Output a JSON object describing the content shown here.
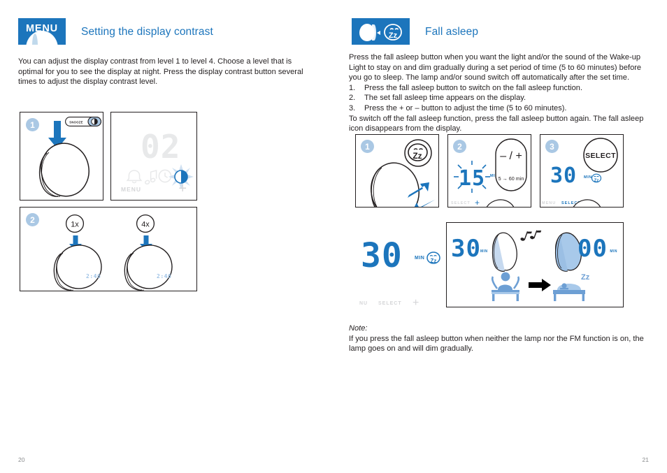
{
  "document": {
    "left_page_number": "20",
    "right_page_number": "21"
  },
  "colors": {
    "brand_blue": "#1c75bc",
    "step_badge": "#aac8e4",
    "text": "#231f20",
    "ghost_grey": "#e8e9ea"
  },
  "left": {
    "header": {
      "badge_label": "MENU",
      "badge_icon": "menu-lamp-icon",
      "title": "Setting the display contrast"
    },
    "intro": "You can adjust the display contrast from level 1 to level 4. Choose a level that is optimal for you to see the display at night. Press the display contrast button several times to adjust the display contrast level.",
    "figure1": {
      "step_number": "1",
      "snooze_label": "SNOOZE",
      "contrast_icon": "contrast-half-circle-icon",
      "arrow_icon": "down-arrow-icon",
      "lamp_icon": "wake-up-light-lamp-icon"
    },
    "figure2": {
      "display_value": "02",
      "icons": [
        "alarm-bell-icon",
        "music-note-icon",
        "clock-icon",
        "contrast-half-circle-icon"
      ],
      "menu_label": "MENU",
      "plus_label": "+"
    },
    "figure3": {
      "step_number": "2",
      "press_left": "1x",
      "press_right": "4x",
      "arrow_icon": "down-arrow-icon",
      "lamp_icon": "wake-up-light-lamp-icon"
    }
  },
  "right": {
    "header": {
      "badge_icon": "fall-asleep-lamp-zz-icon",
      "title": "Fall asleep"
    },
    "intro": "Press the fall asleep button when you want the light and/or the sound of the Wake-up Light to stay on and dim gradually during a set period of time (5 to 60 minutes) before you go to sleep. The lamp and/or sound switch off automatically after the set time.",
    "steps": [
      {
        "num": "1.",
        "text": "Press the fall asleep button to switch on the fall asleep function."
      },
      {
        "num": "2.",
        "text": "The set fall asleep time appears on the display."
      },
      {
        "num": "3.",
        "text": "Press the + or – button to adjust the time (5 to 60 minutes)."
      }
    ],
    "outro": "To switch off the fall asleep function, press the fall asleep button again. The fall asleep icon disappears from the display.",
    "note": {
      "label": "Note:",
      "text": "If you press the fall asleep button when neither the lamp nor the FM function is on, the lamp goes on and will dim gradually."
    },
    "figure_step1": {
      "step_number": "1",
      "zz_icon": "fall-asleep-zz-button-icon",
      "zz_text": "Zz",
      "arrow_icon": "press-arrow-icon",
      "lamp_icon": "wake-up-light-lamp-icon"
    },
    "figure_step2": {
      "step_number": "2",
      "display_value": "15",
      "min_label": "MIN",
      "zz_icon": "fall-asleep-zz-icon",
      "button_label": "– / +",
      "range_label": "5 → 60 min",
      "bottom_labels": [
        "SELECT",
        "+"
      ]
    },
    "figure_step3": {
      "step_number": "3",
      "select_label": "SELECT",
      "display_value": "30",
      "min_label": "MIN",
      "zz_icon": "fall-asleep-zz-icon",
      "bottom_labels": [
        "MENU",
        "SELECT",
        "+"
      ]
    },
    "figure_display": {
      "display_value": "30",
      "min_label": "MIN",
      "zz_icon": "fall-asleep-zz-icon",
      "bottom_labels": [
        "NU",
        "SELECT",
        "+"
      ]
    },
    "figure_dimming": {
      "start_value": "30",
      "start_min_label": "MIN",
      "end_value": "00",
      "end_min_label": "MIN",
      "music_icon": "music-notes-icon",
      "arrow_icon": "right-arrow-icon",
      "bed_awake_icon": "person-awake-in-bed-icon",
      "bed_asleep_icon": "person-asleep-in-bed-icon",
      "zz_text": "Zz"
    }
  }
}
